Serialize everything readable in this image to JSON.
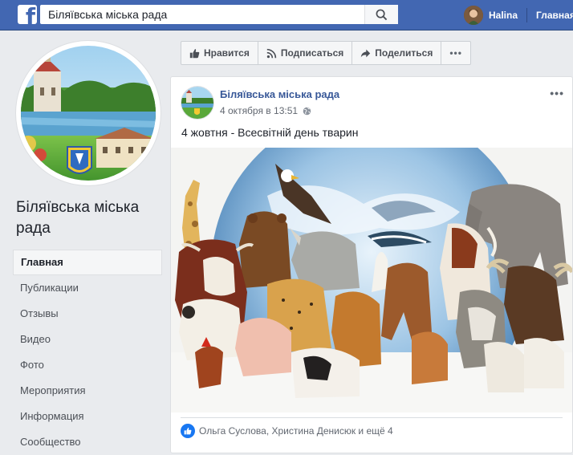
{
  "topbar": {
    "search_value": "Біляївська міська рада",
    "user_name": "Halina",
    "home_label": "Главная"
  },
  "page": {
    "name": "Біляївська міська рада"
  },
  "nav": {
    "items": [
      {
        "label": "Главная",
        "active": true
      },
      {
        "label": "Публикации"
      },
      {
        "label": "Отзывы"
      },
      {
        "label": "Видео"
      },
      {
        "label": "Фото"
      },
      {
        "label": "Мероприятия"
      },
      {
        "label": "Информация"
      },
      {
        "label": "Сообщество"
      }
    ]
  },
  "actions": {
    "like_label": "Нравится",
    "subscribe_label": "Подписаться",
    "share_label": "Поделиться",
    "more_label": "•••"
  },
  "post": {
    "author": "Біляївська міська рада",
    "timestamp": "4 октября в 13:51",
    "text": "4 жовтня - Всесвітній день тварин",
    "more_label": "•••",
    "reactions_text": "Ольга Суслова, Христина Денисюк и ещё 4"
  },
  "colors": {
    "brand": "#4267b2",
    "link": "#385898",
    "like": "#1877f2"
  }
}
